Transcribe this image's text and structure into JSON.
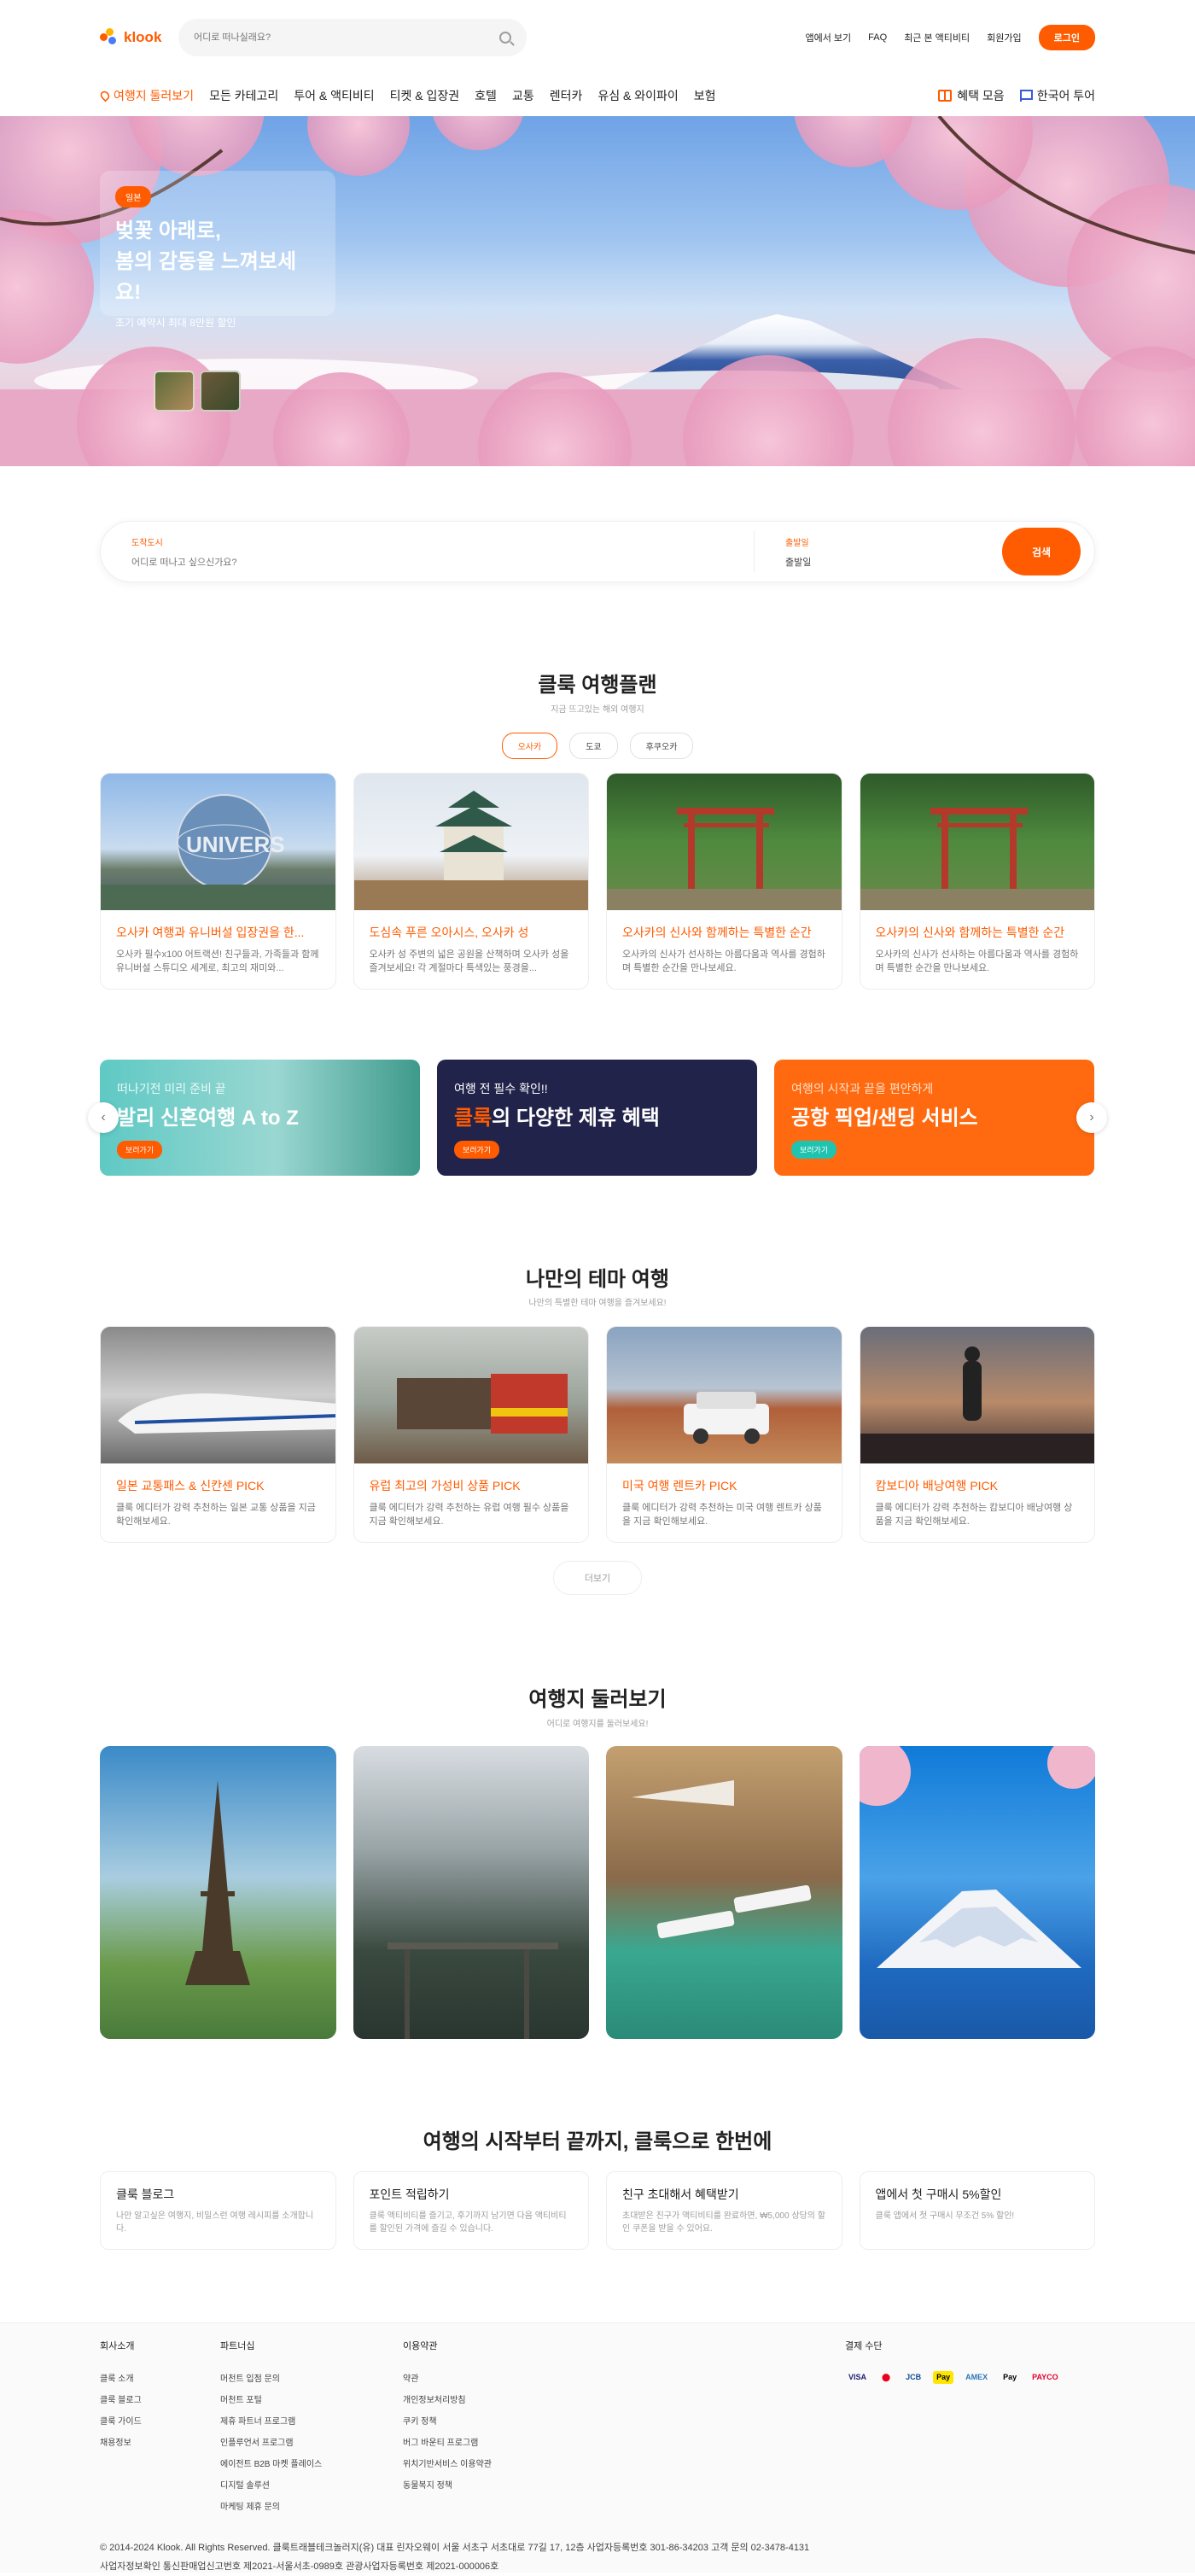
{
  "brand": {
    "name": "klook",
    "accent": "#ff5b00"
  },
  "header": {
    "search_placeholder": "어디로 떠나실래요?",
    "links": [
      "앱에서 보기",
      "FAQ",
      "최근 본 액티비티",
      "회원가입"
    ],
    "login": "로그인"
  },
  "nav": {
    "items": [
      "여행지 둘러보기",
      "모든 카테고리",
      "투어 & 액티비티",
      "티켓 & 입장권",
      "호텔",
      "교통",
      "렌터카",
      "유심 & 와이파이",
      "보험"
    ],
    "right": [
      "혜택 모음",
      "한국어 투어"
    ]
  },
  "hero": {
    "badge": "일본",
    "title_line1": "벚꽃 아래로,",
    "title_line2": "봄의 감동을 느껴보세요!",
    "subtitle": "조기 예약시 최대 8만원 할인"
  },
  "search_box": {
    "dest_label": "도착도시",
    "dest_placeholder": "어디로 떠나고 싶으신가요?",
    "date_label": "출발일",
    "date_value": "출발일",
    "button": "검색"
  },
  "plan": {
    "title": "클룩 여행플랜",
    "subtitle": "지금 뜨고있는 해외 여행지",
    "tabs": [
      "오사카",
      "도쿄",
      "후쿠오카"
    ],
    "cards": [
      {
        "title": "오사카 여행과 유니버설 입장권을 한...",
        "desc": "오사카 필수x100 어트랙션! 친구들과, 가족들과 함께 유니버설 스튜디오 세계로, 최고의 재미와..."
      },
      {
        "title": "도심속 푸른 오아시스, 오사카 성",
        "desc": "오사카 성 주변의 넓은 공원을 산책하며 오사카 성을 즐겨보세요! 각 계절마다 특색있는 풍경을..."
      },
      {
        "title": "오사카의 신사와 함께하는 특별한 순간",
        "desc": "오사카의 신사가 선사하는 아름다움과 역사를 경험하며 특별한 순간을 만나보세요."
      },
      {
        "title": "오사카의 신사와 함께하는 특별한 순간",
        "desc": "오사카의 신사가 선사하는 아름다움과 역사를 경험하며 특별한 순간을 만나보세요."
      }
    ]
  },
  "banners": [
    {
      "small": "떠나기전 미리 준비 끝",
      "big": "발리 신혼여행 A to Z",
      "btn": "보러가기"
    },
    {
      "small": "여행 전 필수 확인!!",
      "big_accent": "클룩",
      "big_rest": "의 다양한 제휴 혜택",
      "btn": "보러가기"
    },
    {
      "small": "여행의 시작과 끝을 편안하게",
      "big": "공항 픽업/샌딩 서비스",
      "btn": "보러가기"
    }
  ],
  "theme": {
    "title": "나만의 테마 여행",
    "subtitle": "나만의 특별한 테마 여행을 즐겨보세요!",
    "cards": [
      {
        "title": "일본 교통패스 & 신칸센 PICK",
        "desc": "클룩 에디터가 강력 추천하는 일본 교통 상품을 지금 확인해보세요."
      },
      {
        "title": "유럽 최고의 가성비 상품 PICK",
        "desc": "클룩 에디터가 강력 추천하는 유럽 여행 필수 상품을 지금 확인해보세요."
      },
      {
        "title": "미국 여행 렌트카 PICK",
        "desc": "클룩 에디터가 강력 추천하는 미국 여행 렌트카 상품을 지금 확인해보세요."
      },
      {
        "title": "캄보디아 배낭여행 PICK",
        "desc": "클룩 에디터가 강력 추천하는 캄보디아 배낭여행 상품을 지금 확인해보세요."
      }
    ],
    "more": "더보기"
  },
  "destinations": {
    "title": "여행지 둘러보기",
    "subtitle": "어디로 여행지를 둘러보세요!"
  },
  "features": {
    "title": "여행의 시작부터 끝까지, 클룩으로 한번에",
    "items": [
      {
        "title": "클룩 블로그",
        "desc": "나만 알고싶은 여행지, 비밀스런 여행 레시피를 소개합니다."
      },
      {
        "title": "포인트 적립하기",
        "desc": "클룩 액티비티를 즐기고, 후기까지 남기면 다음 액티비티를 할인된 가격에 즐길 수 있습니다."
      },
      {
        "title": "친구 초대해서 혜택받기",
        "desc": "초대받은 친구가 액티비티를 완료하면, ₩5,000 상당의 할인 쿠폰을 받을 수 있어요."
      },
      {
        "title": "앱에서 첫 구매시 5%할인",
        "desc": "클룩 앱에서 첫 구매시 무조건 5% 할인!"
      }
    ]
  },
  "footer": {
    "cols": [
      {
        "title": "회사소개",
        "items": [
          "클룩 소개",
          "클룩 블로그",
          "클룩 가이드",
          "채용정보"
        ]
      },
      {
        "title": "파트너십",
        "items": [
          "머천트 입점 문의",
          "머천트 포털",
          "제휴 파트너 프로그램",
          "인플루언서 프로그램",
          "에이전트 B2B 마켓 플레이스",
          "디지털 솔루션",
          "마케팅 제휴 문의"
        ]
      },
      {
        "title": "이용약관",
        "items": [
          "약관",
          "개인정보처리방침",
          "쿠키 정책",
          "버그 바운티 프로그램",
          "위치기반서비스 이용약관",
          "동물복지 정책"
        ]
      }
    ],
    "payment_title": "결제 수단",
    "payments": [
      "VISA",
      "MC",
      "JCB",
      "Pay",
      "AMEX",
      "Pay",
      "PAYCO"
    ],
    "line1": "© 2014-2024 Klook. All Rights Reserved.   클룩트래블테크놀러지(유)   대표 린자오웨이   서울 서초구 서초대로 77길 17, 12층   사업자등록번호 301-86-34203   고객 문의 02-3478-4131",
    "line2": "사업자정보확인   통신판매업신고번호 제2021-서울서초-0989호   관광사업자등록번호 제2021-000006호"
  }
}
